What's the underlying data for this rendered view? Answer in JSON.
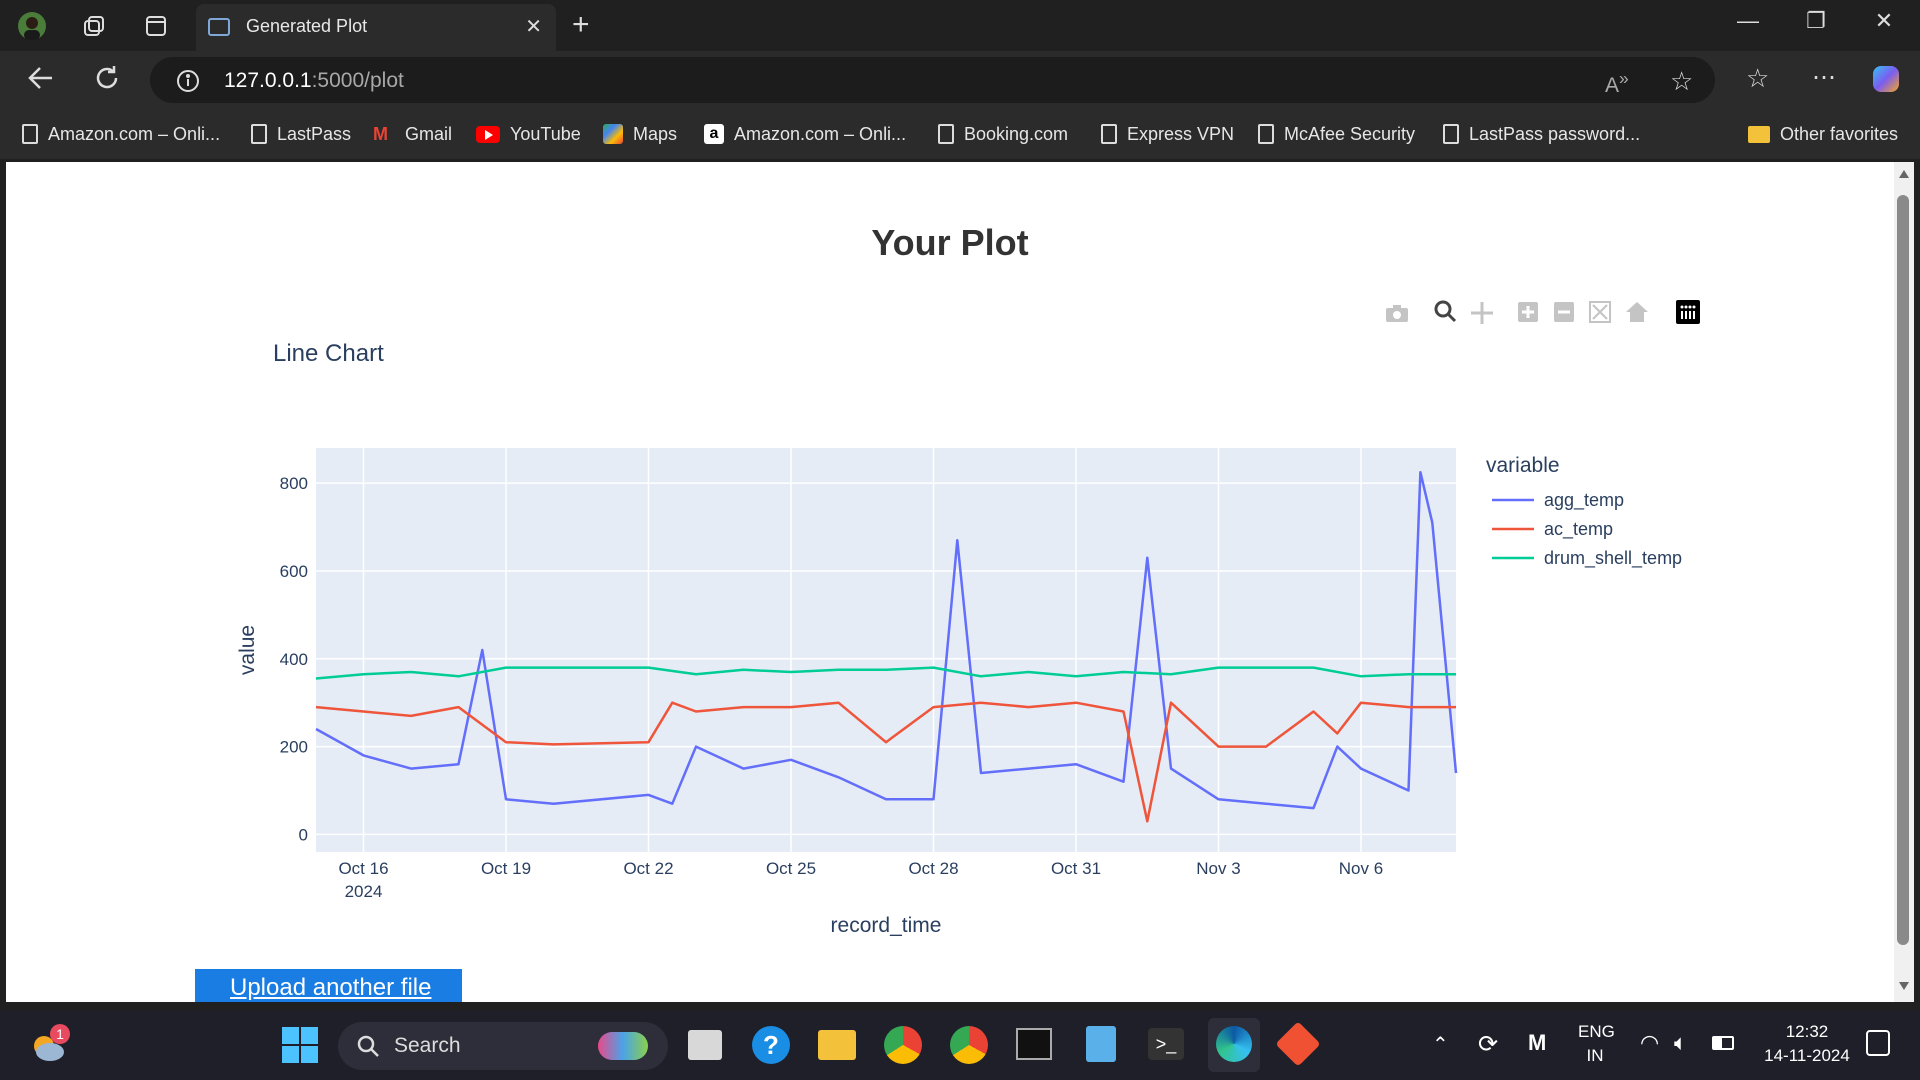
{
  "browser": {
    "tab_title": "Generated Plot",
    "url_host": "127.0.0.1",
    "url_path": ":5000/plot",
    "bookmarks": [
      "Amazon.com – Onli...",
      "LastPass",
      "Gmail",
      "YouTube",
      "Maps",
      "Amazon.com – Onli...",
      "Booking.com",
      "Express VPN",
      "McAfee Security",
      "LastPass password..."
    ],
    "other_favorites": "Other favorites"
  },
  "page": {
    "heading": "Your Plot",
    "upload_link": "Upload another file"
  },
  "chart_data": {
    "type": "line",
    "title": "Line Chart",
    "xlabel": "record_time",
    "ylabel": "value",
    "legend_title": "variable",
    "legend_placement": "right",
    "grid": true,
    "ylim": [
      -40,
      880
    ],
    "xlim": [
      "2024-10-15",
      "2024-11-08"
    ],
    "x_ticks": [
      "Oct 16",
      "Oct 19",
      "Oct 22",
      "Oct 25",
      "Oct 28",
      "Oct 31",
      "Nov 3",
      "Nov 6"
    ],
    "x_tick_year": "2024",
    "y_ticks": [
      0,
      200,
      400,
      600,
      800
    ],
    "series": [
      {
        "name": "agg_temp",
        "color": "#636efa",
        "x": [
          "2024-10-15",
          "2024-10-16",
          "2024-10-17",
          "2024-10-18",
          "2024-10-18T12",
          "2024-10-19",
          "2024-10-20",
          "2024-10-22",
          "2024-10-22T12",
          "2024-10-23",
          "2024-10-24",
          "2024-10-25",
          "2024-10-26",
          "2024-10-27",
          "2024-10-28",
          "2024-10-28T12",
          "2024-10-29",
          "2024-10-30",
          "2024-10-31",
          "2024-11-01",
          "2024-11-01T12",
          "2024-11-02",
          "2024-11-03",
          "2024-11-04",
          "2024-11-05",
          "2024-11-05T12",
          "2024-11-06",
          "2024-11-07",
          "2024-11-07T06",
          "2024-11-07T12",
          "2024-11-08"
        ],
        "values": [
          240,
          180,
          150,
          160,
          420,
          80,
          70,
          90,
          70,
          200,
          150,
          170,
          130,
          80,
          80,
          670,
          140,
          150,
          160,
          120,
          630,
          150,
          80,
          70,
          60,
          200,
          150,
          100,
          825,
          710,
          140
        ]
      },
      {
        "name": "ac_temp",
        "color": "#ef553b",
        "x": [
          "2024-10-15",
          "2024-10-16",
          "2024-10-17",
          "2024-10-18",
          "2024-10-19",
          "2024-10-20",
          "2024-10-22",
          "2024-10-22T12",
          "2024-10-23",
          "2024-10-24",
          "2024-10-25",
          "2024-10-26",
          "2024-10-27",
          "2024-10-28",
          "2024-10-29",
          "2024-10-30",
          "2024-10-31",
          "2024-11-01",
          "2024-11-01T12",
          "2024-11-02",
          "2024-11-03",
          "2024-11-04",
          "2024-11-05",
          "2024-11-05T12",
          "2024-11-06",
          "2024-11-07",
          "2024-11-08"
        ],
        "values": [
          290,
          280,
          270,
          290,
          210,
          205,
          210,
          300,
          280,
          290,
          290,
          300,
          210,
          290,
          300,
          290,
          300,
          280,
          30,
          300,
          200,
          200,
          280,
          230,
          300,
          290,
          290
        ]
      },
      {
        "name": "drum_shell_temp",
        "color": "#00cc96",
        "x": [
          "2024-10-15",
          "2024-10-16",
          "2024-10-17",
          "2024-10-18",
          "2024-10-19",
          "2024-10-20",
          "2024-10-22",
          "2024-10-23",
          "2024-10-24",
          "2024-10-25",
          "2024-10-26",
          "2024-10-27",
          "2024-10-28",
          "2024-10-29",
          "2024-10-30",
          "2024-10-31",
          "2024-11-01",
          "2024-11-02",
          "2024-11-03",
          "2024-11-04",
          "2024-11-05",
          "2024-11-06",
          "2024-11-07",
          "2024-11-08"
        ],
        "values": [
          355,
          365,
          370,
          360,
          380,
          380,
          380,
          365,
          375,
          370,
          375,
          375,
          380,
          360,
          370,
          360,
          370,
          365,
          380,
          380,
          380,
          360,
          365,
          365
        ]
      }
    ]
  },
  "taskbar": {
    "search_label": "Search",
    "notification_count": "1",
    "lang_top": "ENG",
    "lang_bottom": "IN",
    "time": "12:32",
    "date": "14-11-2024"
  }
}
